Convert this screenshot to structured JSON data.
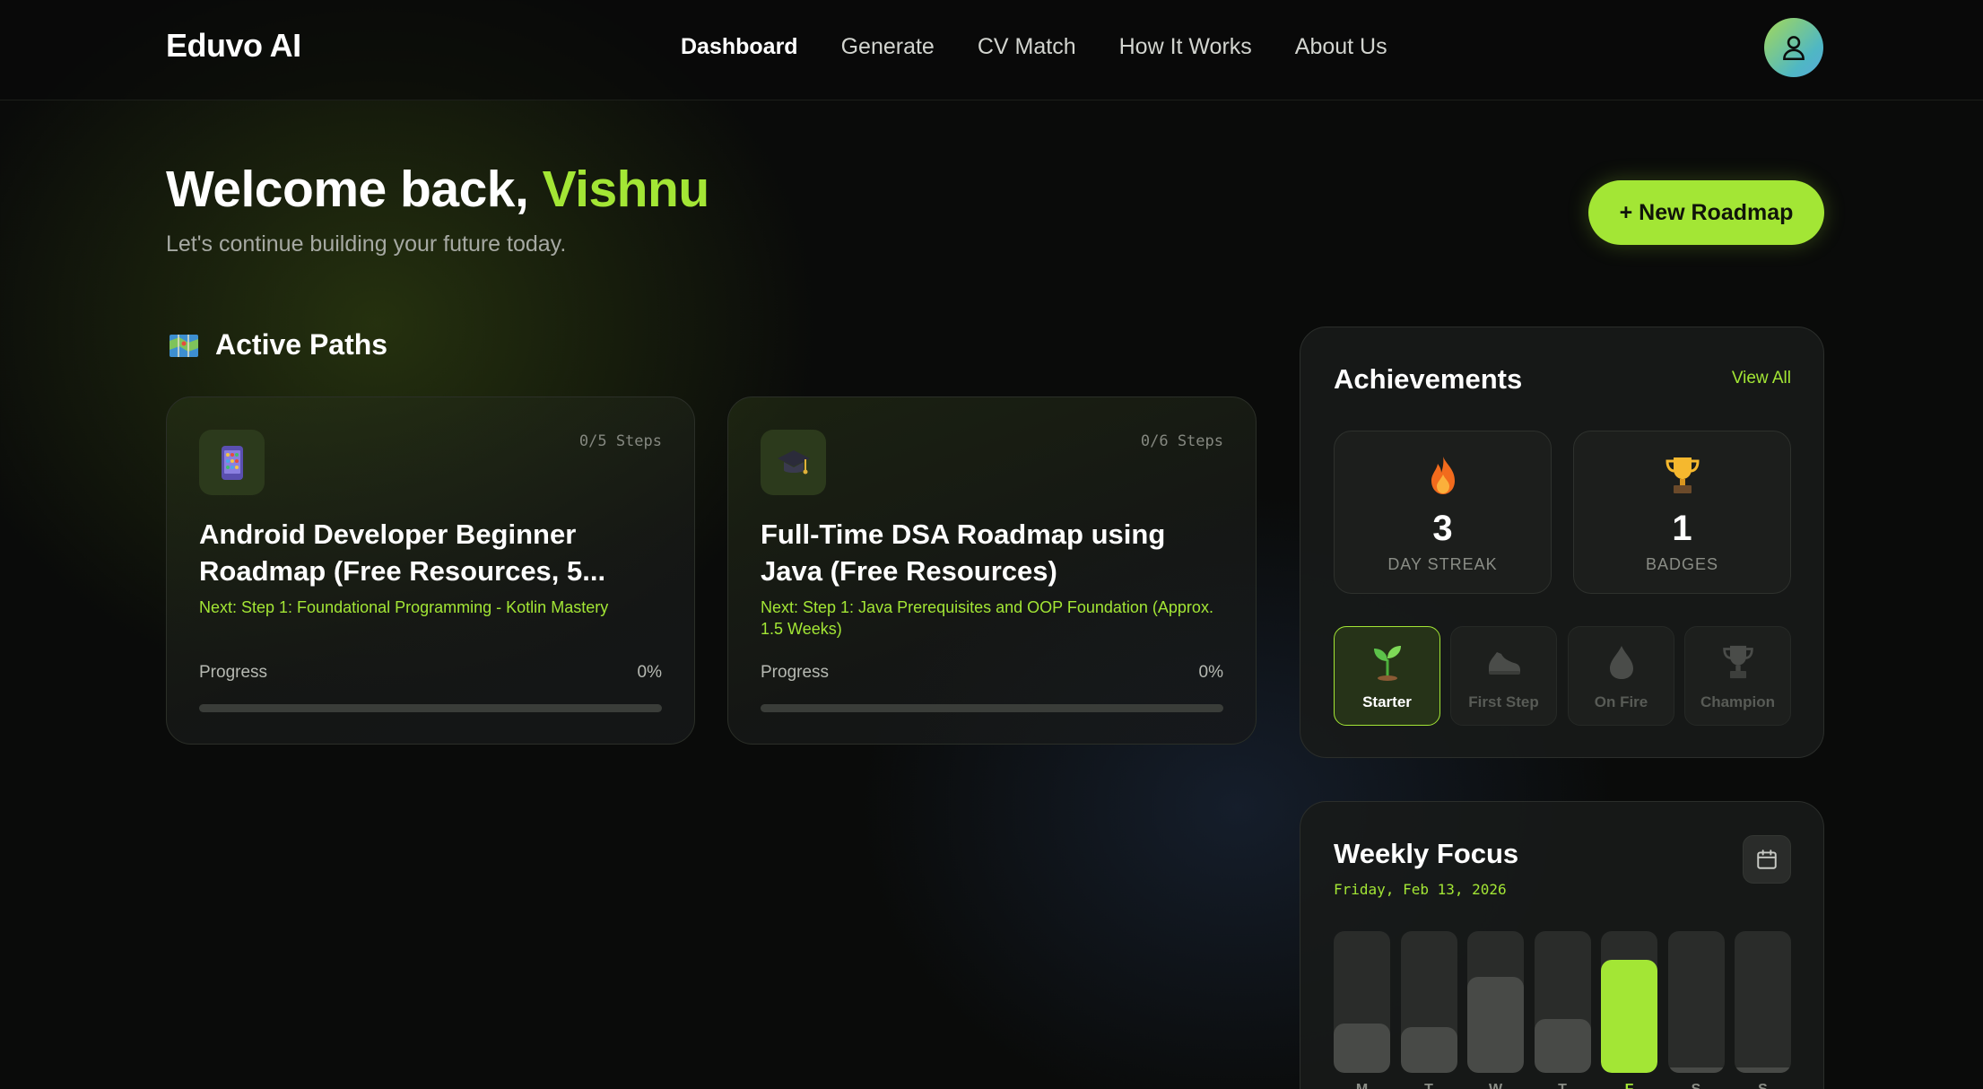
{
  "nav": {
    "brand": "Eduvo AI",
    "links": [
      "Dashboard",
      "Generate",
      "CV Match",
      "How It Works",
      "About Us"
    ],
    "active": "Dashboard",
    "avatar_icon": "user-icon"
  },
  "hero": {
    "greeting": "Welcome back,",
    "name": "Vishnu",
    "subtitle": "Let's continue building your future today.",
    "new_roadmap_label": "+ New Roadmap"
  },
  "active_paths": {
    "title": "Active Paths",
    "title_icon": "map-icon",
    "cards": [
      {
        "icon": "phone-icon",
        "steps": "0/5 Steps",
        "title": "Android Developer Beginner Roadmap (Free Resources, 5...",
        "next": "Next: Step 1: Foundational Programming - Kotlin Mastery",
        "progress_label": "Progress",
        "progress_value": "0%",
        "progress_fraction": 0
      },
      {
        "icon": "graduation-cap-icon",
        "steps": "0/6 Steps",
        "title": "Full-Time DSA Roadmap using Java (Free Resources)",
        "next": "Next: Step 1: Java Prerequisites and OOP Foundation (Approx. 1.5 Weeks)",
        "progress_label": "Progress",
        "progress_value": "0%",
        "progress_fraction": 0
      }
    ]
  },
  "achievements": {
    "title": "Achievements",
    "view_all": "View All",
    "stats": [
      {
        "icon": "fire-icon",
        "value": "3",
        "label": "DAY STREAK"
      },
      {
        "icon": "trophy-icon",
        "value": "1",
        "label": "BADGES"
      }
    ],
    "badges": [
      {
        "icon": "sprout-icon",
        "label": "Starter",
        "unlocked": true
      },
      {
        "icon": "sneaker-icon",
        "label": "First Step",
        "unlocked": false
      },
      {
        "icon": "drop-icon",
        "label": "On Fire",
        "unlocked": false
      },
      {
        "icon": "trophy-icon",
        "label": "Champion",
        "unlocked": false
      }
    ]
  },
  "weekly_focus": {
    "title": "Weekly Focus",
    "date": "Friday, Feb 13, 2026",
    "calendar_icon": "calendar-icon",
    "accent": "#a3e635",
    "days": [
      "M",
      "T",
      "W",
      "T",
      "F",
      "S",
      "S"
    ],
    "levels": [
      0.35,
      0.32,
      0.68,
      0.38,
      0.8,
      0.04,
      0.04
    ],
    "today_index": 4
  }
}
